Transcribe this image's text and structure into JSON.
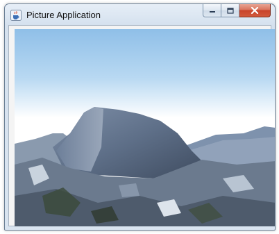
{
  "window": {
    "title": "Picture Application",
    "icon": "java-cup-icon",
    "caption_buttons": [
      "minimize-icon",
      "maximize-icon",
      "close-icon"
    ]
  },
  "picture": {
    "subject": "mountain-photo"
  },
  "colors": {
    "titlebar": "#d5e1ee",
    "close_button": "#c8432a",
    "sky": "#9cc8ec",
    "rock": "#5f7088"
  }
}
